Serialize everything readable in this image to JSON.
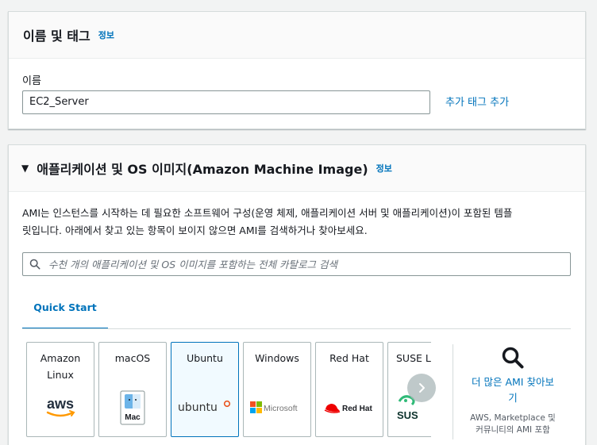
{
  "name_section": {
    "title": "이름 및 태그",
    "info": "정보",
    "field_label": "이름",
    "name_value": "EC2_Server",
    "add_tag": "추가 태그 추가"
  },
  "ami_section": {
    "title": "애플리케이션 및 OS 이미지(Amazon Machine Image)",
    "info": "정보",
    "description_line1": "AMI는 인스턴스를 시작하는 데 필요한 소프트웨어 구성(운영 체제, 애플리케이션 서버 및 애플리케이션)이 포함된 템플",
    "description_line2": "릿입니다. 아래에서 찾고 있는 항목이 보이지 않으면 AMI를 검색하거나 찾아보세요.",
    "search_placeholder": "수천 개의 애플리케이션 및 OS 이미지를 포함하는 전체 카탈로그 검색",
    "tab_quick_start": "Quick Start",
    "tiles": [
      {
        "line1": "Amazon",
        "line2": "Linux",
        "logo_text": "aws",
        "icon": "aws-logo-icon"
      },
      {
        "line1": "macOS",
        "line2": "",
        "logo_text": "Mac",
        "icon": "mac-logo-icon"
      },
      {
        "line1": "Ubuntu",
        "line2": "",
        "logo_text": "ubuntu",
        "icon": "ubuntu-logo-icon",
        "selected": true
      },
      {
        "line1": "Windows",
        "line2": "",
        "logo_text": "Microsoft",
        "icon": "microsoft-logo-icon"
      },
      {
        "line1": "Red Hat",
        "line2": "",
        "logo_text": "Red Hat",
        "icon": "redhat-logo-icon"
      },
      {
        "line1": "SUSE L",
        "line2": "",
        "logo_text": "SUS",
        "icon": "suse-logo-icon"
      }
    ],
    "more_link_line1": "더 많은 AMI 찾아보",
    "more_link_line2": "기",
    "more_sub_line1": "AWS, Marketplace 및",
    "more_sub_line2": "커뮤니티의 AMI 포함"
  },
  "colors": {
    "link": "#0073bb",
    "selected_border": "#0073bb",
    "selected_bg": "#f1faff",
    "aws_orange": "#ff9900",
    "ubuntu_orange": "#e95420",
    "redhat_red": "#ee0000",
    "suse_green": "#30ba78"
  }
}
